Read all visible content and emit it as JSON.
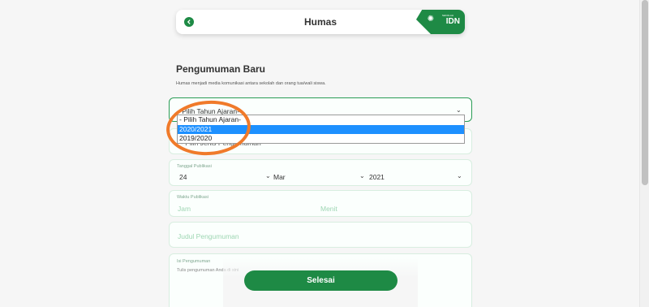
{
  "header": {
    "title": "Humas",
    "brand_name": "IDN",
    "brand_tagline": "SEKOLAH"
  },
  "intro": {
    "title": "Pengumuman Baru",
    "description": "Humas menjadi media komunikasi antara sekolah dan orang tua/wali siswa."
  },
  "form": {
    "tahun_ajaran": {
      "selected": "- Pilih Tahun Ajaran-",
      "options": [
        "- Pilih Tahun Ajaran-",
        "2020/2021",
        "2019/2020"
      ],
      "highlighted_option": "2020/2021"
    },
    "second_select_hidden_text": "- Pilih Jenis Pengumuman",
    "tanggal_publikasi": {
      "label": "Tanggal Publikasi",
      "day": "24",
      "month": "Mar",
      "year": "2021"
    },
    "waktu_publikasi": {
      "label": "Waktu Publikasi",
      "hour_placeholder": "Jam",
      "minute_placeholder": "Menit"
    },
    "judul_placeholder": "Judul Pengumuman",
    "isi": {
      "label": "Isi Pengumuman",
      "placeholder": "Tulis pengumuman Anda di sini"
    }
  },
  "submit_label": "Selesai",
  "colors": {
    "primary": "#1e8a45",
    "annotation": "#f07a2a",
    "selected_option": "#1e90ff"
  }
}
